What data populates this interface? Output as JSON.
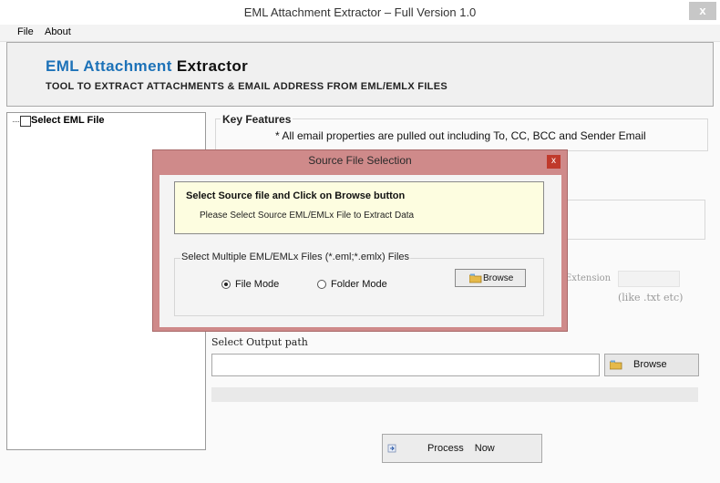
{
  "window": {
    "title": "EML Attachment Extractor – Full Version 1.0",
    "close_label": "x"
  },
  "menu": {
    "items": [
      "File",
      "About"
    ]
  },
  "banner": {
    "app_name_accent": "EML Attachment",
    "app_name_rest": "Extractor",
    "tagline": "TOOL TO EXTRACT ATTACHMENTS & EMAIL ADDRESS FROM EML/EMLX FILES"
  },
  "tree": {
    "root_label": "Select EML File"
  },
  "key_features": {
    "title": "Key Features",
    "text": "* All email properties are pulled out including To, CC, BCC and Sender Email"
  },
  "extension": {
    "label": "Extension",
    "hint": "(like .txt etc)"
  },
  "output": {
    "label": "Select Output path",
    "value": "",
    "browse_label": "Browse"
  },
  "process": {
    "label_part1": "Process",
    "label_part2": "Now"
  },
  "dialog": {
    "title": "Source File Selection",
    "close_label": "x",
    "heading": "Select Source file and Click on Browse button",
    "subtext": "Please Select Source EML/EMLx File to Extract Data",
    "group_title": "Select Multiple EML/EMLx Files (*.eml;*.emlx) Files",
    "radio_file_mode": "File Mode",
    "radio_folder_mode": "Folder Mode",
    "selected_mode": "File Mode",
    "browse_label": "Browse"
  },
  "colors": {
    "accent": "#1d72b8",
    "dialog_frame": "#cf8a8a",
    "notice_bg": "#fdfde0",
    "close_red": "#c0392b"
  }
}
